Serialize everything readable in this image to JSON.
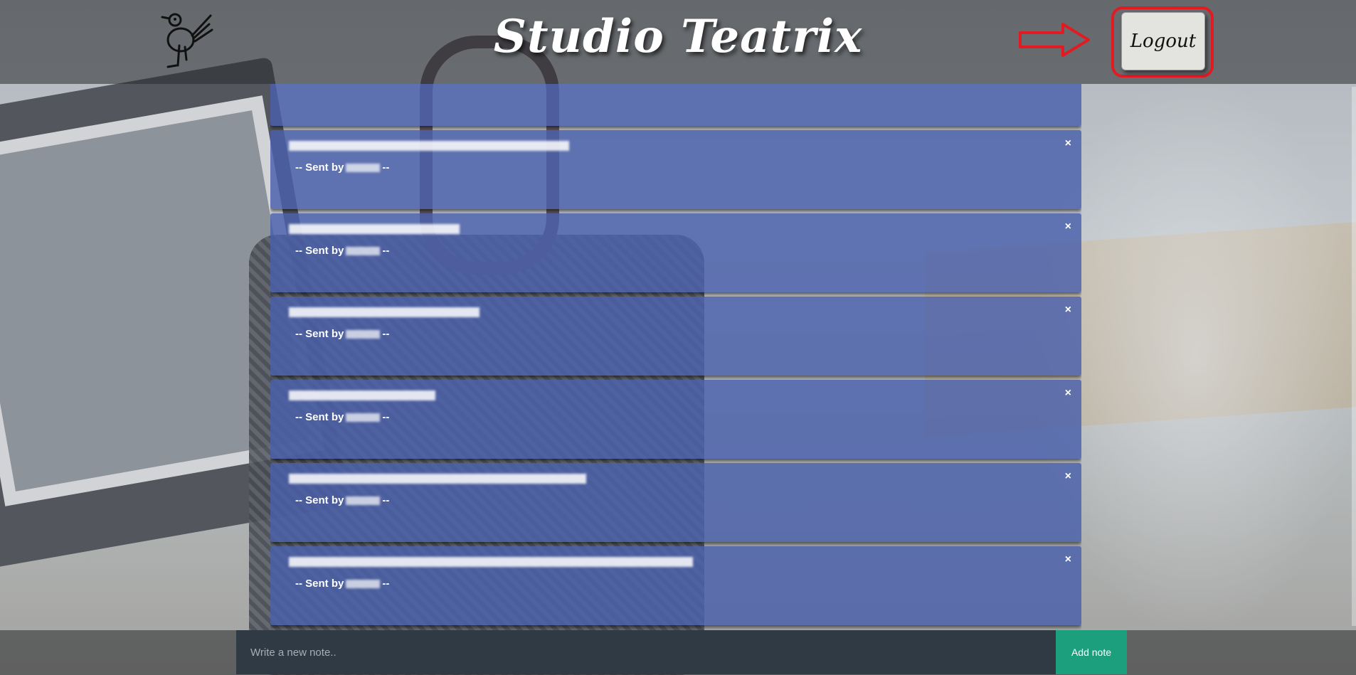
{
  "header": {
    "brand": "Studio Teatrix",
    "logout_label": "Logout"
  },
  "icons": {
    "logo": "bird-logo-icon",
    "arrow": "red-arrow-icon",
    "close": "close-icon"
  },
  "colors": {
    "note_bg": "#495fab",
    "add_button": "#1b9f7d",
    "highlight": "#e21b23"
  },
  "notes": [
    {
      "sent_prefix": "-- Sent by",
      "sent_suffix": "--",
      "close": "×"
    },
    {
      "sent_prefix": "-- Sent by",
      "sent_suffix": "--",
      "close": "×"
    },
    {
      "sent_prefix": "-- Sent by",
      "sent_suffix": "--",
      "close": "×"
    },
    {
      "sent_prefix": "-- Sent by",
      "sent_suffix": "--",
      "close": "×"
    },
    {
      "sent_prefix": "-- Sent by",
      "sent_suffix": "--",
      "close": "×"
    },
    {
      "sent_prefix": "-- Sent by",
      "sent_suffix": "--",
      "close": "×"
    },
    {
      "sent_prefix": "-- Sent by",
      "sent_suffix": "--",
      "close": "×"
    }
  ],
  "composer": {
    "placeholder": "Write a new note..",
    "add_label": "Add note"
  }
}
